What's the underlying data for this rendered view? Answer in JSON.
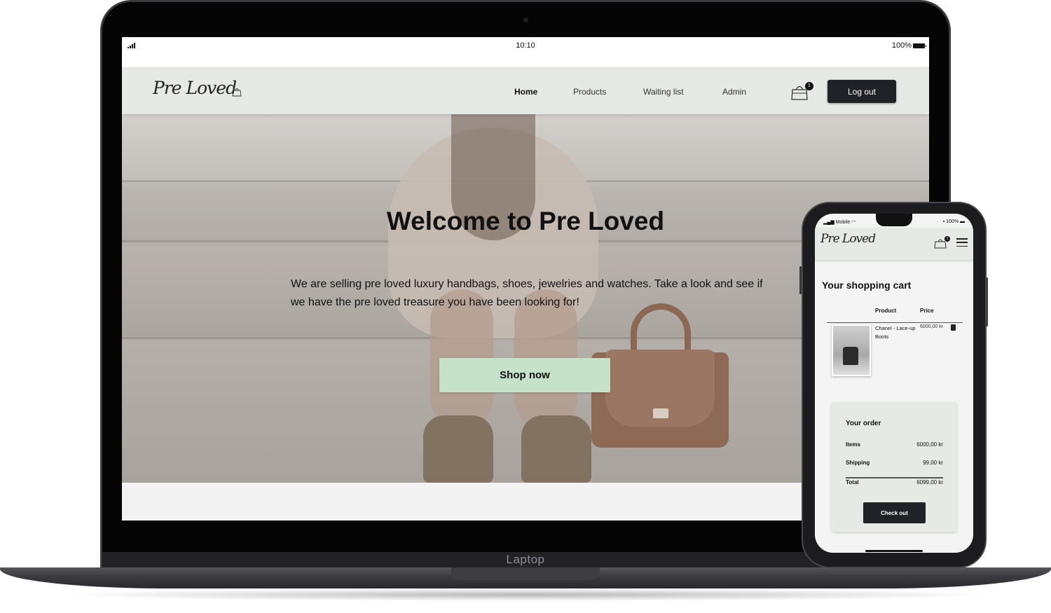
{
  "device_laptop": {
    "label": "Laptop",
    "status": {
      "time": "10:10",
      "battery": "100%"
    },
    "nav": {
      "logo": "Pre Loved",
      "links": [
        "Home",
        "Products",
        "Waiting list",
        "Admin"
      ],
      "active": "Home",
      "cart_count": "1",
      "logout_label": "Log out"
    },
    "hero": {
      "title": "Welcome to Pre Loved",
      "text": "We are selling pre loved luxury handbags, shoes, jewelries and watches. Take a look and see if we have the pre loved treasure you have been looking for!",
      "cta": "Shop now"
    }
  },
  "device_phone": {
    "status": {
      "carrier": "Mobile",
      "battery": "100%"
    },
    "nav": {
      "logo": "Pre Loved",
      "cart_count": "1"
    },
    "cart": {
      "title": "Your shopping cart",
      "col_product": "Product",
      "col_price": "Price",
      "items": [
        {
          "name": "Chanel - Lace-up Boots",
          "price": "6000,00 kr"
        }
      ]
    },
    "order": {
      "title": "Your order",
      "items_label": "Items",
      "items_value": "6000,00 kr",
      "shipping_label": "Shipping",
      "shipping_value": "99,00 kr",
      "total_label": "Total",
      "total_value": "6099,00 kr",
      "checkout_label": "Check out"
    }
  },
  "colors": {
    "nav_bg": "#e5eae5",
    "cta_bg": "#c6e2c9",
    "dark_button": "#1f2226"
  },
  "icons": [
    "signal-icon",
    "battery-icon",
    "shopping-bag-icon",
    "hamburger-menu-icon",
    "trash-icon",
    "wifi-icon",
    "lock-icon"
  ]
}
